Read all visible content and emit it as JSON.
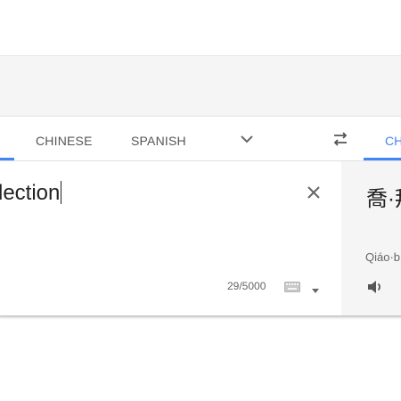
{
  "tabs": {
    "left_items": [
      {
        "label": "CHINESE"
      },
      {
        "label": "SPANISH"
      }
    ],
    "right_item": {
      "label": "CH"
    }
  },
  "source": {
    "text": "lection",
    "char_count": "29/5000"
  },
  "target": {
    "text": "喬·拜",
    "romanization": "Qiáo·b"
  },
  "icons": {
    "more_languages": "chevron-down-icon",
    "swap": "swap-languages-icon",
    "clear": "close-icon",
    "keyboard": "keyboard-icon",
    "keyboard_menu": "caret-down-icon",
    "listen": "speaker-icon"
  },
  "colors": {
    "accent": "#4285f4",
    "tab_text": "#555555",
    "pane_bg": "#f5f5f5"
  }
}
